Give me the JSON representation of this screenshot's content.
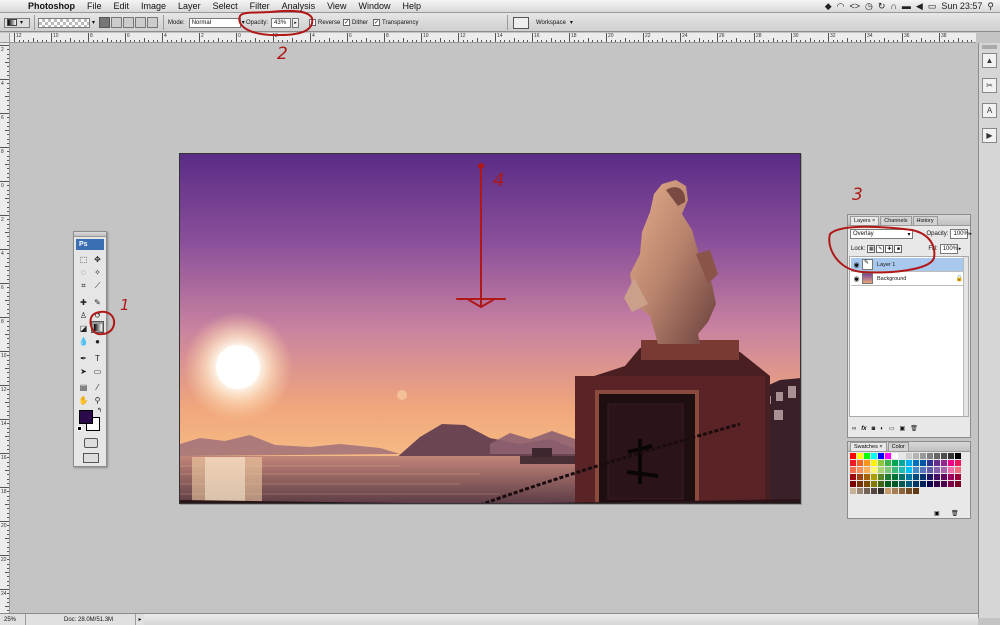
{
  "menubar": {
    "app_name": "Photoshop",
    "items": [
      "File",
      "Edit",
      "Image",
      "Layer",
      "Select",
      "Filter",
      "Analysis",
      "View",
      "Window",
      "Help"
    ],
    "clock": "Sun 23:57"
  },
  "options": {
    "mode_label": "Mode:",
    "mode_value": "Normal",
    "opacity_label": "Opacity:",
    "opacity_value": "43%",
    "reverse_label": "Reverse",
    "dither_label": "Dither",
    "transparency_label": "Transparency",
    "workspace_label": "Workspace"
  },
  "rulers": {
    "h_labels": [
      "12",
      "10",
      "8",
      "6",
      "4",
      "2",
      "0",
      "2",
      "4",
      "6",
      "8",
      "10",
      "12",
      "14",
      "16",
      "18",
      "20",
      "22",
      "24",
      "26",
      "28",
      "30",
      "32",
      "34",
      "36",
      "38",
      "40",
      "42"
    ],
    "v_labels": [
      "2",
      "4",
      "6",
      "8",
      "0",
      "2",
      "4",
      "6",
      "8",
      "10",
      "12",
      "14",
      "16",
      "18",
      "20",
      "22",
      "24"
    ]
  },
  "toolbox": {
    "logo": "Ps"
  },
  "layers_panel": {
    "tabs": [
      "Layers",
      "Channels",
      "History"
    ],
    "blend_mode": "Overlay",
    "opacity_label": "Opacity:",
    "opacity_value": "100%",
    "lock_label": "Lock:",
    "fill_label": "Fill:",
    "fill_value": "100%",
    "layers": [
      {
        "name": "Layer 1",
        "selected": true
      },
      {
        "name": "Background",
        "selected": false
      }
    ]
  },
  "swatches_panel": {
    "tabs": [
      "Swatches",
      "Color"
    ]
  },
  "status": {
    "zoom": "25%",
    "doc": "Doc: 28.0M/51.3M"
  },
  "annotations": {
    "n1": "1",
    "n2": "2",
    "n3": "3",
    "n4": "4"
  },
  "colors": {
    "foreground": "#2a0a4a",
    "background": "#ffffff",
    "annotation": "#b01818"
  }
}
